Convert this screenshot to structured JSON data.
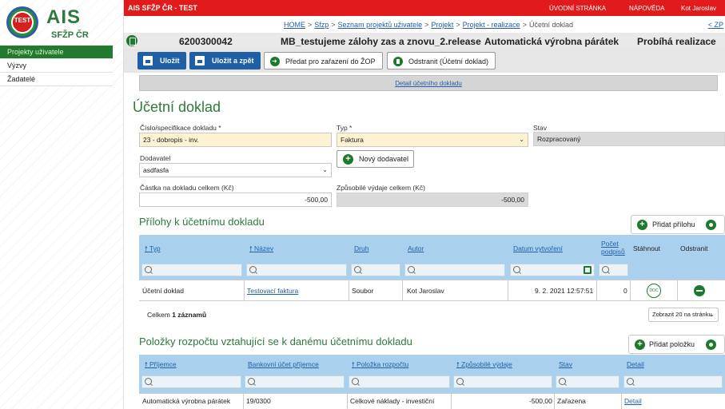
{
  "brand": {
    "logo_badge": "TEST",
    "logo_name": "AIS",
    "logo_sub": "SFŽP ČR"
  },
  "sidebar": {
    "items": [
      {
        "label": "Projekty uživatele",
        "active": true
      },
      {
        "label": "Výzvy",
        "active": false
      },
      {
        "label": "Žadatelé",
        "active": false
      }
    ]
  },
  "topbar": {
    "app_name": "AIS SFŽP ČR - TEST",
    "home": "ÚVODNÍ STRÁNKA",
    "help": "NÁPOVĚDA",
    "user": "Kot Jaroslav"
  },
  "breadcrumb": {
    "items": [
      "HOME",
      "Sfzp",
      "Seznam projektů uživatele",
      "Projekt",
      "Projekt - realizace"
    ],
    "current": "Účetní doklad",
    "back": "< ZP"
  },
  "header": {
    "id": "6200300042",
    "name": "MB_testujeme zálohy zas a znovu_2.release",
    "company": "Automatická výrobna párátek",
    "status": "Probíhá realizace"
  },
  "toolbar": {
    "save": "Uložit",
    "save_back": "Uložit a zpět",
    "submit": "Předat pro zařazení do ŽOP",
    "delete": "Odstranit (Účetní doklad)"
  },
  "detail_link": "Detail účetního dokladu",
  "form": {
    "title": "Účetní doklad",
    "doc_no_label": "Číslo/specifikace dokladu *",
    "doc_no_value": "23 - dobropis - inv.",
    "type_label": "Typ *",
    "type_value": "Faktura",
    "state_label": "Stav",
    "state_value": "Rozpracovaný",
    "supplier_label": "Dodavatel",
    "supplier_value": "asdfasfa",
    "new_supplier": "Nový dodavatel",
    "amount_label": "Částka na dokladu celkem (Kč)",
    "amount_value": "-500,00",
    "eligible_label": "Způsobilé výdaje celkem (Kč)",
    "eligible_value": "-500,00"
  },
  "attachments": {
    "title": "Přílohy k účetnímu dokladu",
    "add": "Přidat přílohu",
    "columns": [
      "Typ",
      "Název",
      "Druh",
      "Autor",
      "Datum vytvoření",
      "Počet podpisů",
      "Stáhnout",
      "Odstranit"
    ],
    "rows": [
      {
        "type": "Účetní doklad",
        "name": "Testovací faktura",
        "kind": "Soubor",
        "author": "Kot Jaroslav",
        "date": "9. 2. 2021 12:57:51",
        "signatures": "0",
        "download": "DOC"
      }
    ],
    "total_prefix": "Celkem",
    "total_count": "1 záznamů",
    "page_size": "Zobrazit 20 na stránku"
  },
  "budget": {
    "title": "Položky rozpočtu vztahující se k danému účetnímu dokladu",
    "add": "Přidat položku",
    "columns": [
      "Příjemce",
      "Bankovní účet příjemce",
      "Položka rozpočtu",
      "Způsobilé výdaje",
      "Stav",
      "Detail"
    ],
    "rows": [
      {
        "recipient": "Automatická výrobna párátek",
        "account": "19/0300",
        "item": "Celkové náklady - investiční",
        "eligible": "-500,00",
        "state": "Zařazena",
        "detail": "Detail"
      }
    ]
  }
}
